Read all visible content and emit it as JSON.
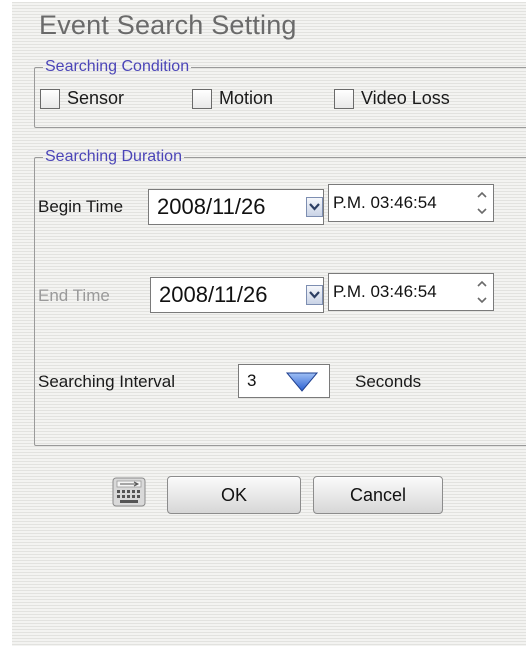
{
  "dialog": {
    "title": "Event Search Setting"
  },
  "condition": {
    "legend": "Searching Condition",
    "options": [
      {
        "label": "Sensor",
        "checked": false
      },
      {
        "label": "Motion",
        "checked": false
      },
      {
        "label": "Video Loss",
        "checked": false
      }
    ]
  },
  "duration": {
    "legend": "Searching Duration",
    "begin": {
      "label": "Begin Time",
      "date": "2008/11/26",
      "time": "P.M. 03:46:54"
    },
    "end": {
      "label": "End Time",
      "date": "2008/11/26",
      "time": "P.M. 03:46:54"
    },
    "interval": {
      "label": "Searching Interval",
      "value": "3",
      "unit": "Seconds"
    }
  },
  "actions": {
    "ok_label": "OK",
    "cancel_label": "Cancel",
    "keyboard_icon": "keyboard-icon"
  },
  "colors": {
    "legend": "#4b45b8",
    "dropdown_arrow": "#3a6fd8"
  }
}
